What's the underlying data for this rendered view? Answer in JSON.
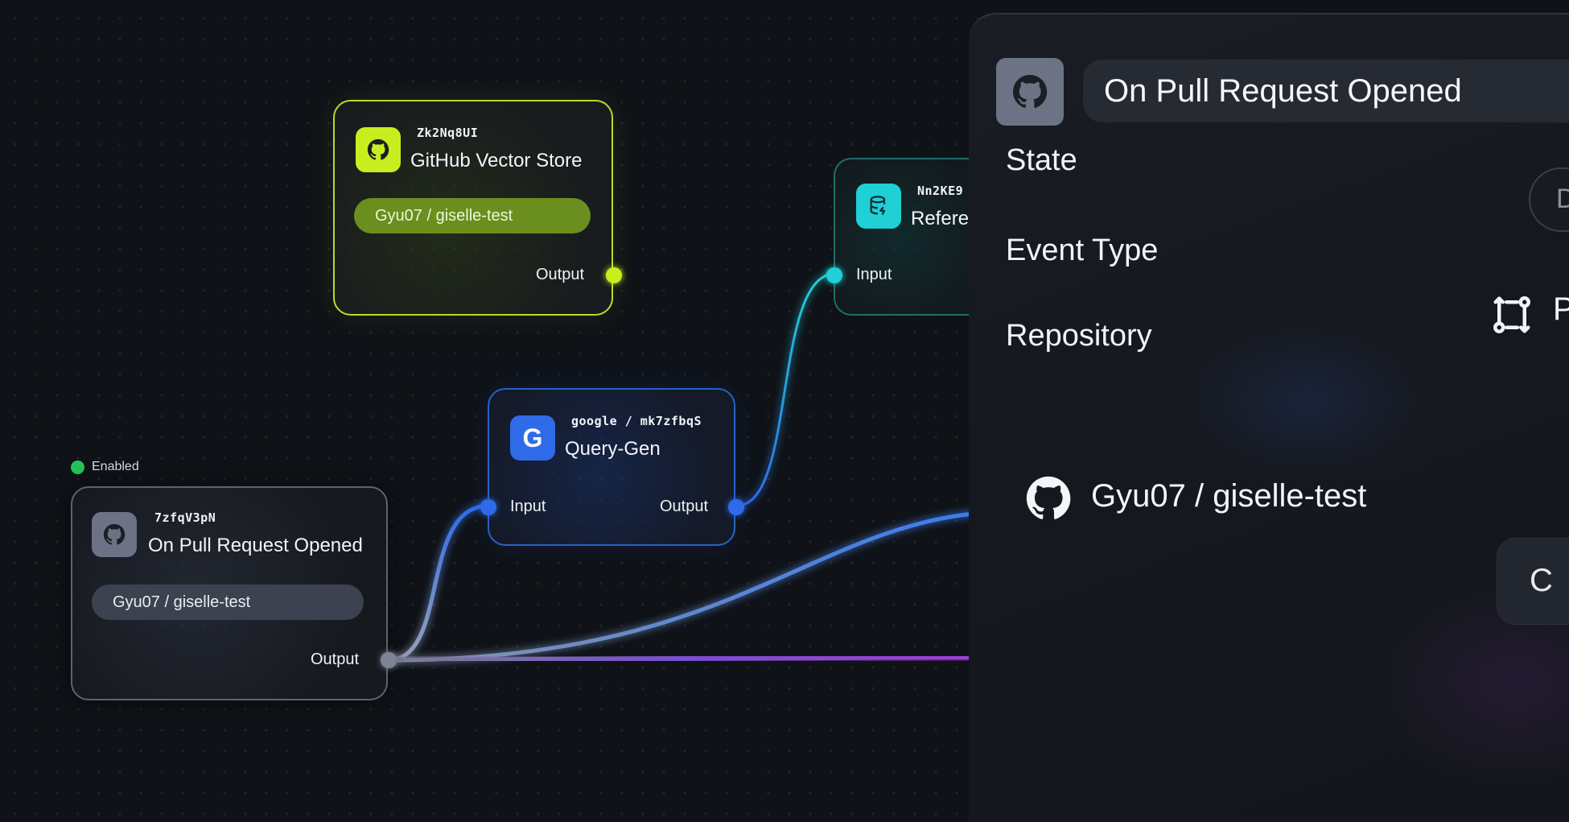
{
  "colors": {
    "vector_accent": "#b7dc2a",
    "reference_accent": "#1fd0d4",
    "query_accent": "#2f6be8",
    "trigger_accent": "#6b7384",
    "enabled": "#23c55e",
    "wire_purple": "#8b3fd6"
  },
  "nodes": {
    "vector_store": {
      "id": "Zk2Nq8UI",
      "title": "GitHub Vector Store",
      "repo": "Gyu07 / giselle-test",
      "output_label": "Output",
      "icon": "github-icon"
    },
    "reference": {
      "id": "Nn2KE9",
      "title": "Refere",
      "input_label": "Input",
      "icon": "database-icon"
    },
    "query_gen": {
      "id": "google / mk7zfbqS",
      "title": "Query-Gen",
      "input_label": "Input",
      "output_label": "Output",
      "icon": "google-icon",
      "icon_letter": "G"
    },
    "trigger": {
      "status": "Enabled",
      "id": "7zfqV3pN",
      "title": "On Pull Request Opened",
      "repo": "Gyu07 / giselle-test",
      "output_label": "Output",
      "icon": "github-icon"
    }
  },
  "panel": {
    "title": "On Pull Request Opened",
    "icon": "github-icon",
    "state_label": "State",
    "state_toggle_text": "D",
    "event_type_label": "Event Type",
    "event_type_icon": "pull-request-icon",
    "event_type_value": "P",
    "repository_label": "Repository",
    "repository_icon": "github-icon",
    "repository_value": "Gyu07 / giselle-test",
    "button_text": "C"
  }
}
